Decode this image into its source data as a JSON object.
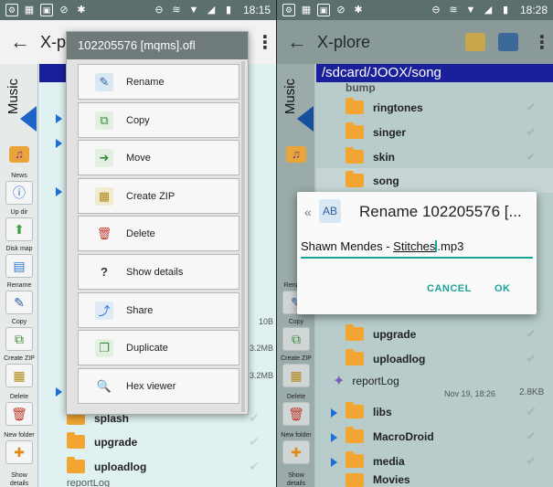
{
  "left": {
    "status": {
      "time": "18:15"
    },
    "appbar": {
      "title": "X-p"
    },
    "panel": {
      "tab_label": "Music"
    },
    "tools": [
      {
        "label": "News",
        "icon": "info-icon"
      },
      {
        "label": "Up dir",
        "icon": "up-arrow-icon"
      },
      {
        "label": "Disk map",
        "icon": "disk-map-icon"
      },
      {
        "label": "Rename",
        "icon": "rename-icon"
      },
      {
        "label": "Copy",
        "icon": "copy-icon"
      },
      {
        "label": "Create ZIP",
        "icon": "zip-icon"
      },
      {
        "label": "Delete",
        "icon": "trash-icon"
      },
      {
        "label": "New folder",
        "icon": "new-folder-icon"
      },
      {
        "label": "Show details",
        "icon": "details-icon"
      }
    ],
    "context_menu": {
      "title": "102205576 [mqms].ofl",
      "items": [
        {
          "label": "Rename",
          "icon": "rename-icon"
        },
        {
          "label": "Copy",
          "icon": "copy-icon"
        },
        {
          "label": "Move",
          "icon": "move-icon"
        },
        {
          "label": "Create ZIP",
          "icon": "zip-icon"
        },
        {
          "label": "Delete",
          "icon": "trash-icon"
        },
        {
          "label": "Show details",
          "icon": "question-icon"
        },
        {
          "label": "Share",
          "icon": "share-icon"
        },
        {
          "label": "Duplicate",
          "icon": "duplicate-icon"
        },
        {
          "label": "Hex viewer",
          "icon": "magnifier-icon"
        }
      ]
    },
    "sizes": [
      "10B",
      "3.2MB",
      "3.2MB"
    ],
    "folders": [
      {
        "name": "splash"
      },
      {
        "name": "upgrade"
      },
      {
        "name": "uploadlog"
      }
    ],
    "partial_row": "reportLog"
  },
  "right": {
    "status": {
      "time": "18:28"
    },
    "appbar": {
      "title": "X-plore"
    },
    "path": "/sdcard/JOOX/song",
    "top_partial": "bump",
    "folders_top": [
      {
        "name": "ringtones"
      },
      {
        "name": "singer"
      },
      {
        "name": "skin"
      },
      {
        "name": "song"
      }
    ],
    "dialog": {
      "title": "Rename 102205576 [...",
      "input_prefix": "Shawn Mendes - ",
      "input_selected": "Stitches",
      "input_suffix": ".mp3",
      "cancel_label": "CANCEL",
      "ok_label": "OK"
    },
    "folders_mid": [
      {
        "name": "upgrade"
      },
      {
        "name": "uploadlog"
      }
    ],
    "report_log": {
      "name": "reportLog",
      "date": "Nov 19, 18:26",
      "size": "2.8KB"
    },
    "folders_bottom": [
      {
        "name": "libs"
      },
      {
        "name": "MacroDroid"
      },
      {
        "name": "media"
      },
      {
        "name": "Movies"
      }
    ],
    "tools": [
      {
        "label": "Rename",
        "icon": "rename-icon"
      },
      {
        "label": "Copy",
        "icon": "copy-icon"
      },
      {
        "label": "Create ZIP",
        "icon": "zip-icon"
      },
      {
        "label": "Delete",
        "icon": "trash-icon"
      },
      {
        "label": "New folder",
        "icon": "new-folder-icon"
      },
      {
        "label": "Show details",
        "icon": "details-icon"
      }
    ],
    "panel": {
      "tab_label": "Music"
    }
  },
  "colors": {
    "accent": "#1aa39a",
    "path_bar": "#1a1f9a",
    "folder": "#f2a531",
    "status": "#5a6f6e"
  }
}
